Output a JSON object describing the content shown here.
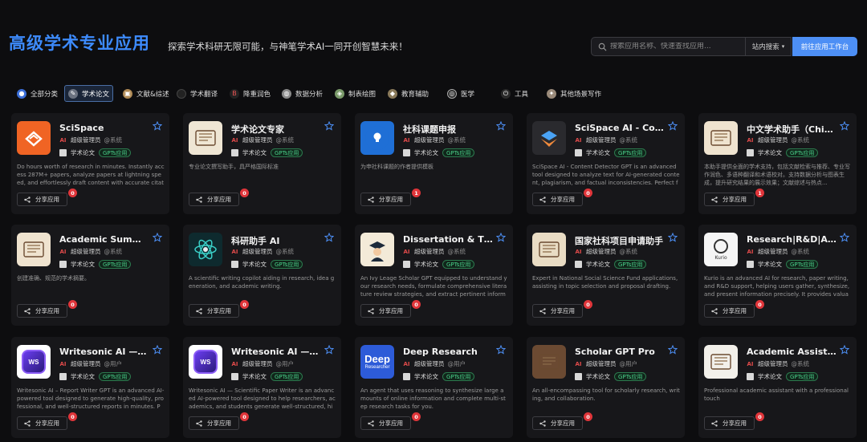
{
  "header": {
    "title": "高级学术专业应用",
    "slogan": "探索学术科研无限可能，与神笔学术AI一同开创智慧未来！",
    "search_placeholder": "搜索应用名称、快速查找应用...",
    "search_scope": "站内搜索",
    "workbench_button": "前往应用工作台"
  },
  "categories": [
    {
      "label": "全部分类",
      "icon": "grid-icon",
      "color": "#3b6ed8"
    },
    {
      "label": "学术论文",
      "icon": "pen-icon",
      "color": "#6b7280",
      "active": true
    },
    {
      "label": "文献&综述",
      "icon": "book-icon",
      "color": "#b08a55"
    },
    {
      "label": "学术翻译",
      "icon": "translate-icon",
      "color": "#222222"
    },
    {
      "label": "降重润色",
      "icon": "brush-icon",
      "color": "#222222"
    },
    {
      "label": "数据分析",
      "icon": "chart-icon",
      "color": "#8a8a8a"
    },
    {
      "label": "制表绘图",
      "icon": "palette-icon",
      "color": "#7a9a6a"
    },
    {
      "label": "教育辅助",
      "icon": "school-icon",
      "color": "#8a7a5a"
    },
    {
      "label": "医学",
      "icon": "medical-icon",
      "color": "#2a2a2a"
    },
    {
      "label": "工具",
      "icon": "tool-icon",
      "color": "#2a2a2a"
    },
    {
      "label": "其他场景写作",
      "icon": "misc-icon",
      "color": "#9a8a7a"
    }
  ],
  "cards": [
    {
      "name": "SciSpace",
      "author": "超级管理员",
      "role": "@系统",
      "tag": "学术论文",
      "badge": "GPTs应用",
      "desc": "Do hours worth of research in minutes. Instantly access 287M+ papers, analyze papers at lightning speed, and effortlessly draft content with accurate citati...",
      "share": "分享应用",
      "count": "0",
      "avatar_bg": "#f06424",
      "avatar_icon": "scispace-logo-icon"
    },
    {
      "name": "学术论文专家",
      "author": "超级管理员",
      "role": "@系统",
      "tag": "学术论文",
      "badge": "GPTs应用",
      "desc": "专业论文撰写助手，具严格国际标准",
      "share": "分享应用",
      "count": "0",
      "avatar_bg": "#efe6d4",
      "avatar_icon": "books-sketch-icon"
    },
    {
      "name": "社科课题申报",
      "author": "超级管理员",
      "role": "@系统",
      "tag": "学术论文",
      "badge": "GPTs应用",
      "desc": "为申社科课题的作者提供模板",
      "share": "分享应用",
      "count": "1",
      "avatar_bg": "#1f6fd6",
      "avatar_icon": "lightbulb-icon"
    },
    {
      "name": "SciSpace AI - Content Detector",
      "author": "超级管理员",
      "role": "@系统",
      "tag": "学术论文",
      "badge": "GPTs应用",
      "desc": "SciSpace AI - Content Detector GPT is an advanced tool designed to analyze text for AI-generated content, plagiarism, and factual inconsistencies. Perfect for ...",
      "share": "分享应用",
      "count": "0",
      "avatar_bg": "#2a2a2e",
      "avatar_icon": "layers-icon"
    },
    {
      "name": "中文学术助手（Chinese）",
      "author": "超级管理员",
      "role": "@系统",
      "tag": "学术论文",
      "badge": "GPTs应用",
      "desc": "本助手提供全面的学术支持，包括文献检索与推荐、专业写作润色、多语种翻译和术语校对。支持数据分析与图表生成，提升研究结果的展示效果；文献综述与热点...",
      "share": "分享应用",
      "count": "1",
      "avatar_bg": "#efe3cf",
      "avatar_icon": "scholar-sketch-icon"
    },
    {
      "name": "Academic Summeries",
      "author": "超级管理员",
      "role": "@系统",
      "tag": "学术论文",
      "badge": "GPTs应用",
      "desc": "创建准确、规范的学术摘要。",
      "share": "分享应用",
      "count": "0",
      "avatar_bg": "#efe3cf",
      "avatar_icon": "library-sketch-icon"
    },
    {
      "name": "科研助手 AI",
      "author": "超级管理员",
      "role": "@系统",
      "tag": "学术论文",
      "badge": "GPTs应用",
      "desc": "A scientific writing copilot aiding in research, idea generation, and academic writing.",
      "share": "分享应用",
      "count": "0",
      "avatar_bg": "#0e2a2e",
      "avatar_icon": "atom-icon"
    },
    {
      "name": "Dissertation & Thesis GPT",
      "author": "超级管理员",
      "role": "@系统",
      "tag": "学术论文",
      "badge": "GPTs应用",
      "desc": "An Ivy Leage Scholar GPT equipped to understand your research needs, formulate comprehensive literature review strategies, and extract pertinent informat...",
      "share": "分享应用",
      "count": "0",
      "avatar_bg": "#f3ead8",
      "avatar_icon": "graduate-icon"
    },
    {
      "name": "国家社科项目申请助手",
      "author": "超级管理员",
      "role": "@系统",
      "tag": "学术论文",
      "badge": "GPTs应用",
      "desc": "Expert in National Social Science Fund applications, assisting in topic selection and proposal drafting.",
      "share": "分享应用",
      "count": "0",
      "avatar_bg": "#e9dcc4",
      "avatar_icon": "desk-sketch-icon"
    },
    {
      "name": "Research|R&D|Academic",
      "author": "超级管理员",
      "role": "@系统",
      "tag": "学术论文",
      "badge": "GPTs应用",
      "desc": "Kurio is an advanced AI for research, paper writing, and R&D support, helping users gather, synthesize, and present information precisely. It provides valuabl...",
      "share": "分享应用",
      "count": "0",
      "avatar_bg": "#f5f5f5",
      "avatar_icon": "kurio-logo-icon",
      "avatar_text": "Kurio"
    },
    {
      "name": "Writesonic AI — Report Writer",
      "author": "超级管理员",
      "role": "@用户",
      "tag": "学术论文",
      "badge": "GPTs应用",
      "desc": "Writesonic AI – Report Writer GPT is an advanced AI-powered tool designed to generate high-quality, professional, and well-structured reports in minutes. Pe...",
      "share": "分享应用",
      "count": "0",
      "avatar_bg": "#ffffff",
      "avatar_icon": "writesonic-logo-icon",
      "avatar_text": "WS"
    },
    {
      "name": "Writesonic AI — Scientific Paper Writer",
      "author": "超级管理员",
      "role": "@用户",
      "tag": "学术论文",
      "badge": "GPTs应用",
      "desc": "Writesonic AI — Scientific Paper Writer is an advanced AI-powered tool designed to help researchers, academics, and students generate well-structured, hig...",
      "share": "分享应用",
      "count": "0",
      "avatar_bg": "#ffffff",
      "avatar_icon": "writesonic-logo-icon",
      "avatar_text": "WS"
    },
    {
      "name": "Deep Research",
      "author": "超级管理员",
      "role": "@用户",
      "tag": "学术论文",
      "badge": "GPTs应用",
      "desc": "An agent that uses reasoning to synthesize large amounts of online information and complete multi-step research tasks for you.",
      "share": "分享应用",
      "count": "0",
      "avatar_bg": "#2d5bd8",
      "avatar_icon": "deep-research-logo-icon",
      "avatar_text": "Deep",
      "avatar_sub": "Researcher"
    },
    {
      "name": "Scholar GPT Pro",
      "author": "超级管理员",
      "role": "@用户",
      "tag": "学术论文",
      "badge": "GPTs应用",
      "desc": "An all-encompassing tool for scholarly research, writing, and collaboration.",
      "share": "分享应用",
      "count": "0",
      "avatar_bg": "#6b4a32",
      "avatar_icon": "library-photo-icon"
    },
    {
      "name": "Academic Assistant Pro",
      "author": "超级管理员",
      "role": "@系统",
      "tag": "学术论文",
      "badge": "GPTs应用",
      "desc": "Professional academic assistant with a professional touch",
      "share": "分享应用",
      "count": "0",
      "avatar_bg": "#f2f0ea",
      "avatar_icon": "portrait-sketch-icon"
    }
  ]
}
